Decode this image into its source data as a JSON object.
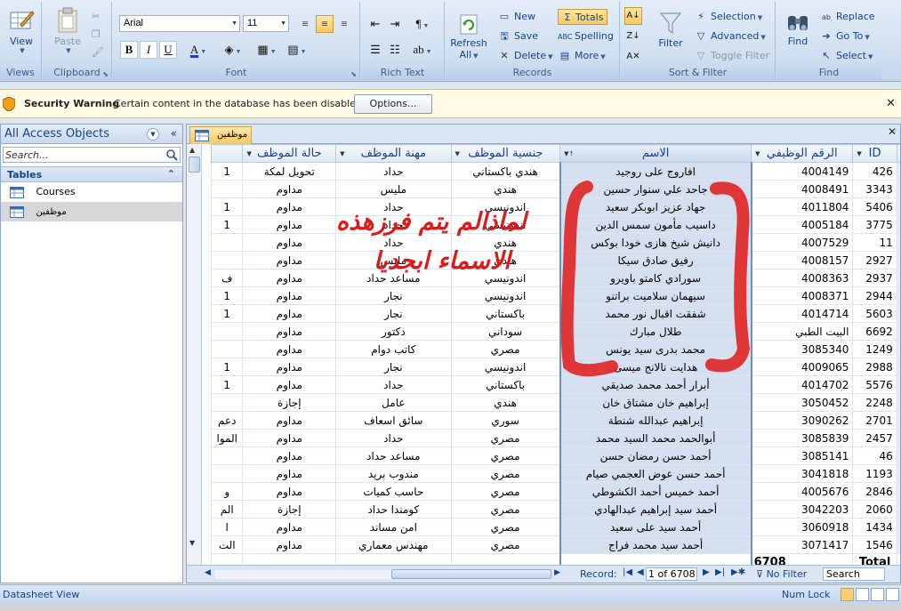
{
  "ribbon": {
    "views": {
      "label": "Views",
      "view_button": "View"
    },
    "clipboard": {
      "label": "Clipboard",
      "paste": "Paste"
    },
    "font": {
      "label": "Font",
      "family": "Arial",
      "size": "11"
    },
    "rich_text": {
      "label": "Rich Text"
    },
    "records": {
      "label": "Records",
      "refresh": "Refresh",
      "refresh_sub": "All",
      "new": "New",
      "save": "Save",
      "delete": "Delete",
      "totals": "Totals",
      "spelling": "Spelling",
      "more": "More"
    },
    "sort_filter": {
      "label": "Sort & Filter",
      "filter": "Filter",
      "selection": "Selection",
      "advanced": "Advanced",
      "toggle_filter": "Toggle Filter"
    },
    "find": {
      "label": "Find",
      "find": "Find",
      "replace": "Replace",
      "goto": "Go To",
      "select": "Select"
    }
  },
  "security_bar": {
    "title": "Security Warning",
    "message": "Certain content in the database has been disabled",
    "options_button": "Options..."
  },
  "nav_pane": {
    "title": "All Access Objects",
    "search_placeholder": "Search...",
    "section": "Tables",
    "items": [
      {
        "label": "Courses"
      },
      {
        "label": "موظفين"
      }
    ]
  },
  "document_tab": {
    "label": "موظفين"
  },
  "datasheet": {
    "columns": {
      "id": "ID",
      "job_number": "الرقم الوظيفي",
      "name": "الاسم",
      "nationality": "جنسية الموظف",
      "profession": "مهنة الموظف",
      "status": "حالة الموظف"
    },
    "rows": [
      {
        "id": "426",
        "job": "4004149",
        "name": "افاروج على روجيد",
        "nat": "هندي باكستاني",
        "prof": "حداد",
        "status": "تحويل لمكة",
        "extra": "1"
      },
      {
        "id": "3343",
        "job": "4008491",
        "name": "جاحد علي سنوار حسين",
        "nat": "هندي",
        "prof": "مليس",
        "status": "مداوم",
        "extra": ""
      },
      {
        "id": "5406",
        "job": "4011804",
        "name": "جهاد عزيز ابوبكر سعيد",
        "nat": "اندونيسي",
        "prof": "حداد",
        "status": "مداوم",
        "extra": "1"
      },
      {
        "id": "3775",
        "job": "4005184",
        "name": "داسيب مأمون سمس الدين",
        "nat": "اندونيسي",
        "prof": "حداد",
        "status": "مداوم",
        "extra": "1"
      },
      {
        "id": "11",
        "job": "4007529",
        "name": "دانيش شيخ هازى خودا بوكس",
        "nat": "هندي",
        "prof": "حداد",
        "status": "مداوم",
        "extra": ""
      },
      {
        "id": "2927",
        "job": "4008157",
        "name": "رفيق صادق سيكا",
        "nat": "هندي",
        "prof": "مليس",
        "status": "مداوم",
        "extra": ""
      },
      {
        "id": "2937",
        "job": "4008363",
        "name": "سورادي كامتو باويرو",
        "nat": "اندونيسي",
        "prof": "مساعد حداد",
        "status": "مداوم",
        "extra": "ف"
      },
      {
        "id": "2944",
        "job": "4008371",
        "name": "سيهمان سلاميت براتنو",
        "nat": "اندونيسي",
        "prof": "نجار",
        "status": "مداوم",
        "extra": "1"
      },
      {
        "id": "5603",
        "job": "4014714",
        "name": "شفقت اقبال نور محمد",
        "nat": "باكستاني",
        "prof": "نجار",
        "status": "مداوم",
        "extra": "1"
      },
      {
        "id": "6692",
        "job": "البيت الطبي",
        "name": "طلال مبارك",
        "nat": "سوداني",
        "prof": "دكتور",
        "status": "مداوم",
        "extra": ""
      },
      {
        "id": "1249",
        "job": "3085340",
        "name": "محمد بدرى سيد يونس",
        "nat": "مصري",
        "prof": "كاتب دوام",
        "status": "مداوم",
        "extra": ""
      },
      {
        "id": "2988",
        "job": "4009065",
        "name": "هدايت نالانج ميسى",
        "nat": "اندونيسي",
        "prof": "نجار",
        "status": "مداوم",
        "extra": "1"
      },
      {
        "id": "5576",
        "job": "4014702",
        "name": "أبرار أحمد محمد صديقي",
        "nat": "باكستاني",
        "prof": "حداد",
        "status": "مداوم",
        "extra": "1"
      },
      {
        "id": "2248",
        "job": "3050452",
        "name": "إبراهيم خان مشتاق خان",
        "nat": "هندي",
        "prof": "عامل",
        "status": "إجازة",
        "extra": ""
      },
      {
        "id": "2701",
        "job": "3090262",
        "name": "إبراهيم عبدالله شنطة",
        "nat": "سوري",
        "prof": "سائق اسعاف",
        "status": "مداوم",
        "extra": "دعم"
      },
      {
        "id": "2457",
        "job": "3085839",
        "name": "أبوالحمد محمد السيد محمد",
        "nat": "مصري",
        "prof": "حداد",
        "status": "مداوم",
        "extra": "الموا"
      },
      {
        "id": "46",
        "job": "3085141",
        "name": "أحمد حسن رمضان حسن",
        "nat": "مصري",
        "prof": "مساعد حداد",
        "status": "مداوم",
        "extra": ""
      },
      {
        "id": "1193",
        "job": "3041818",
        "name": "أحمد حسن عوض العجمي صيام",
        "nat": "مصري",
        "prof": "مندوب بريد",
        "status": "مداوم",
        "extra": ""
      },
      {
        "id": "2846",
        "job": "4005676",
        "name": "أحمد خميس أحمد الكشوطي",
        "nat": "مصري",
        "prof": "حاسب كميات",
        "status": "مداوم",
        "extra": "و"
      },
      {
        "id": "2060",
        "job": "3042203",
        "name": "أحمد سيد إبراهيم عبدالهادي",
        "nat": "مصري",
        "prof": "كومندا حداد",
        "status": "إجازة",
        "extra": "الم"
      },
      {
        "id": "1434",
        "job": "3060918",
        "name": "أحمد سيد على سعيد",
        "nat": "مصري",
        "prof": "امن مساند",
        "status": "مداوم",
        "extra": "ا"
      },
      {
        "id": "1546",
        "job": "3071417",
        "name": "أحمد سيد محمد فراج",
        "nat": "مصري",
        "prof": "مهندس معماري",
        "status": "مداوم",
        "extra": "الت"
      }
    ],
    "total_label": "Total",
    "total_value": "6708"
  },
  "record_nav": {
    "label": "Record:",
    "position": "1 of 6708",
    "filter": "No Filter",
    "search": "Search"
  },
  "annotation": {
    "line1": "لماذالم يتم فرزهذه",
    "line2": "الاسماء ابجديا",
    "color": "#e01818"
  },
  "status_bar": {
    "left": "Datasheet View",
    "right": "Num Lock"
  }
}
